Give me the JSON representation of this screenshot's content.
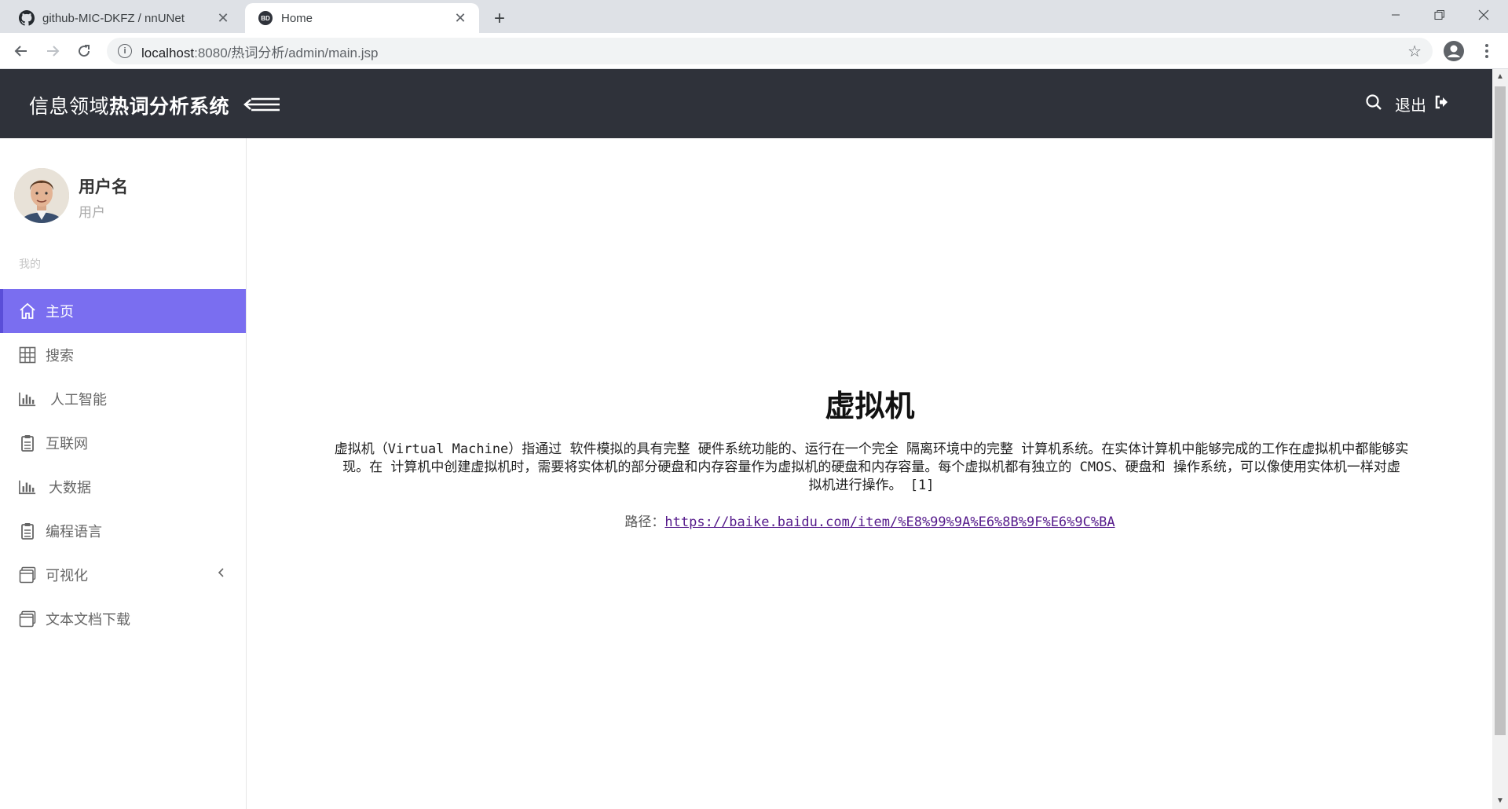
{
  "browser": {
    "tabs": [
      {
        "title": "github-MIC-DKFZ / nnUNet",
        "icon": "github-icon",
        "active": false
      },
      {
        "title": "Home",
        "icon": "baidu-icon",
        "active": true
      }
    ],
    "favicon_text": "BD",
    "url_host": "localhost",
    "url_rest": ":8080/热词分析/admin/main.jsp"
  },
  "header": {
    "brand_light": "信息领域",
    "brand_bold": "热词分析系统",
    "logout_label": "退出",
    "bg_color": "#2f323a"
  },
  "sidebar": {
    "user_name": "用户名",
    "user_role": "用户",
    "section_label": "我的",
    "accent_color": "#7a6ef0",
    "items": [
      {
        "label": "主页",
        "icon": "home-icon",
        "active": true
      },
      {
        "label": "搜索",
        "icon": "grid-icon",
        "active": false
      },
      {
        "label": "人工智能",
        "icon": "bar-chart-icon",
        "active": false
      },
      {
        "label": "互联网",
        "icon": "clipboard-icon",
        "active": false
      },
      {
        "label": "大数据",
        "icon": "bar-chart-icon",
        "active": false
      },
      {
        "label": "编程语言",
        "icon": "clipboard-icon",
        "active": false
      },
      {
        "label": "可视化",
        "icon": "window-icon",
        "active": false,
        "has_submenu": true
      },
      {
        "label": "文本文档下载",
        "icon": "window-icon",
        "active": false
      }
    ]
  },
  "main": {
    "title": "虚拟机",
    "body_line1": "虚拟机（Virtual Machine）指通过 软件模拟的具有完整 硬件系统功能的、运行在一个完全 隔离环境中的完整 计算机系统。在实体计算机中能够完成的工作在虚拟机中都能够实",
    "body_line2": "现。在 计算机中创建虚拟机时，需要将实体机的部分硬盘和内存容量作为虚拟机的硬盘和内存容量。每个虚拟机都有独立的 CMOS、硬盘和 操作系统，可以像使用实体机一样对虚",
    "body_line3": "拟机进行操作。 [1]",
    "path_label": "路径：",
    "path_url": "https://baike.baidu.com/item/%E8%99%9A%E6%8B%9F%E6%9C%BA"
  }
}
